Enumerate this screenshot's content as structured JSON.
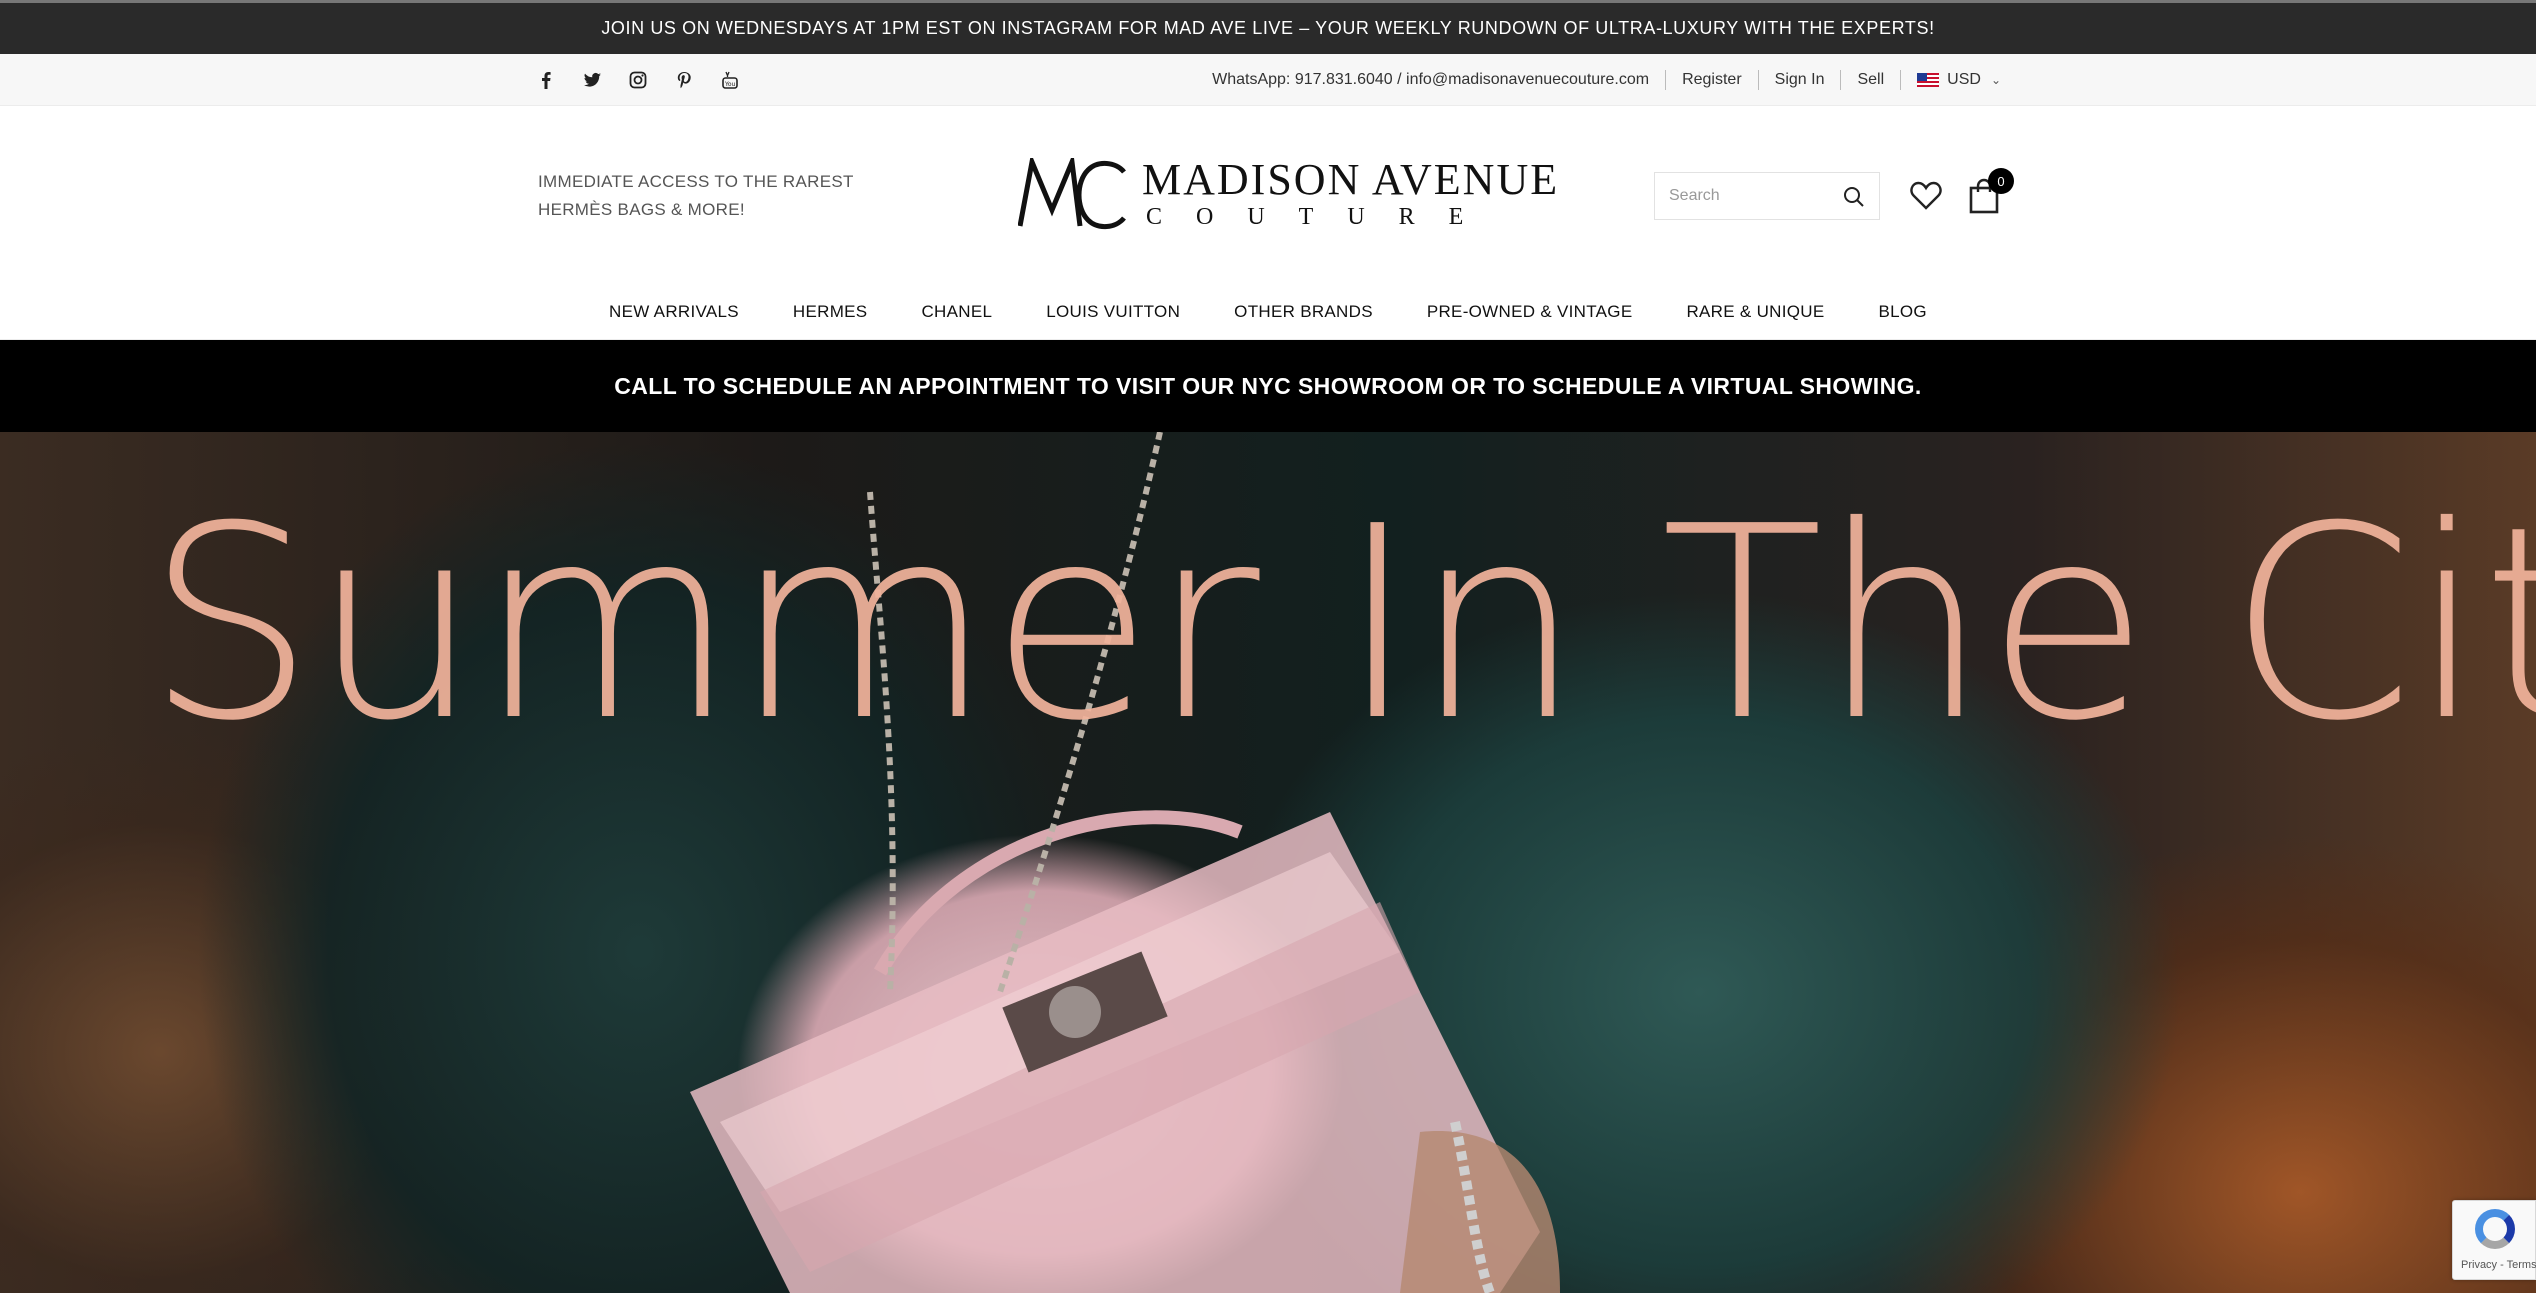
{
  "announcement": "JOIN US ON WEDNESDAYS AT 1PM EST ON INSTAGRAM FOR MAD AVE LIVE – YOUR WEEKLY RUNDOWN OF ULTRA-LUXURY WITH THE EXPERTS!",
  "topbar": {
    "social": [
      "facebook-icon",
      "twitter-icon",
      "instagram-icon",
      "pinterest-icon",
      "youtube-icon"
    ],
    "contact": "WhatsApp: 917.831.6040 / info@madisonavenuecouture.com",
    "register": "Register",
    "sign_in": "Sign In",
    "sell": "Sell",
    "currency": "USD"
  },
  "header": {
    "tagline_line1": "IMMEDIATE ACCESS TO THE RAREST",
    "tagline_line2": "HERMÈS BAGS & MORE!",
    "logo_line1": "MADISON AVENUE",
    "logo_line2": "COUTURE",
    "search_placeholder": "Search",
    "cart_count": "0"
  },
  "nav": {
    "items": [
      "NEW ARRIVALS",
      "HERMES",
      "CHANEL",
      "LOUIS VUITTON",
      "OTHER BRANDS",
      "PRE-OWNED & VINTAGE",
      "RARE & UNIQUE",
      "BLOG"
    ]
  },
  "promo": "CALL TO SCHEDULE AN APPOINTMENT TO VISIT OUR NYC SHOWROOM OR TO SCHEDULE A VIRTUAL SHOWING.",
  "hero": {
    "title": "Summer In The City",
    "title_color": "#f1b39b"
  },
  "recaptcha": "Privacy - Terms"
}
